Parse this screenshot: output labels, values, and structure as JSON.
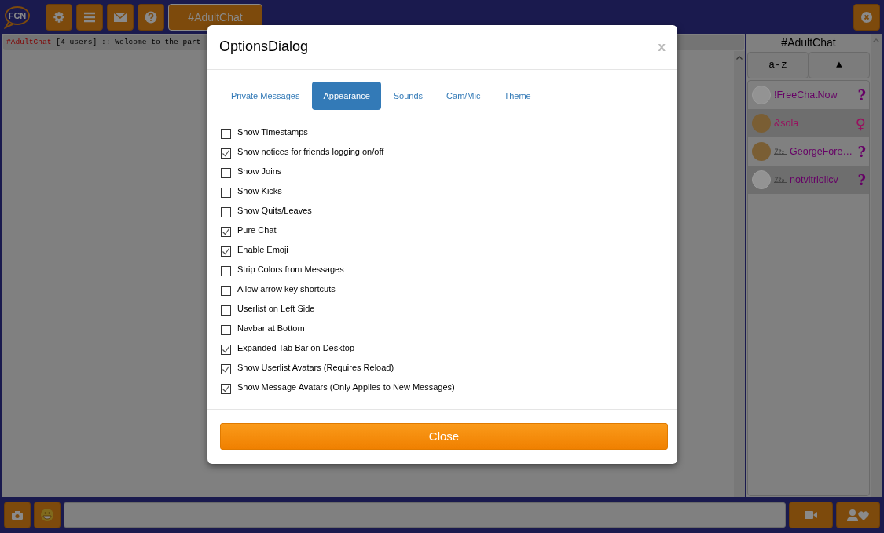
{
  "toolbar": {
    "logo": "FCN",
    "tabs": [
      {
        "label": "#AdultChat",
        "selected": true
      }
    ]
  },
  "chat": {
    "channel": "#AdultChat",
    "topic": "[4 users] :: Welcome to the part"
  },
  "userlist": {
    "title": "#AdultChat",
    "sort_buttons": [
      "a-z",
      "▲"
    ],
    "users": [
      {
        "name": "!FreeChatNow",
        "gender": "?",
        "photo": false,
        "away": false,
        "color": "#660066"
      },
      {
        "name": "&sola",
        "gender": "♀",
        "photo": true,
        "away": false,
        "color": "#99105f"
      },
      {
        "name": "GeorgeFore…",
        "gender": "?",
        "photo": true,
        "away": true,
        "color": "#660066"
      },
      {
        "name": "notvitriolicv",
        "gender": "?",
        "photo": false,
        "away": true,
        "color": "#660066"
      }
    ]
  },
  "dialog": {
    "title": "OptionsDialog",
    "close": "x",
    "tabs": [
      {
        "label": "Private Messages",
        "selected": false
      },
      {
        "label": "Appearance",
        "selected": true
      },
      {
        "label": "Sounds",
        "selected": false
      },
      {
        "label": "Cam/Mic",
        "selected": false
      },
      {
        "label": "Theme",
        "selected": false
      }
    ],
    "options": [
      {
        "label": "Show Timestamps",
        "checked": false
      },
      {
        "label": "Show notices for friends logging on/off",
        "checked": true
      },
      {
        "label": "Show Joins",
        "checked": false
      },
      {
        "label": "Show Kicks",
        "checked": false
      },
      {
        "label": "Show Quits/Leaves",
        "checked": false
      },
      {
        "label": "Pure Chat",
        "checked": true
      },
      {
        "label": "Enable Emoji",
        "checked": true
      },
      {
        "label": "Strip Colors from Messages",
        "checked": false
      },
      {
        "label": "Allow arrow key shortcuts",
        "checked": false
      },
      {
        "label": "Userlist on Left Side",
        "checked": false
      },
      {
        "label": "Navbar at Bottom",
        "checked": false
      },
      {
        "label": "Expanded Tab Bar on Desktop",
        "checked": true
      },
      {
        "label": "Show Userlist Avatars (Requires Reload)",
        "checked": true
      },
      {
        "label": "Show Message Avatars (Only Applies to New Messages)",
        "checked": true
      }
    ],
    "button": "Close"
  }
}
